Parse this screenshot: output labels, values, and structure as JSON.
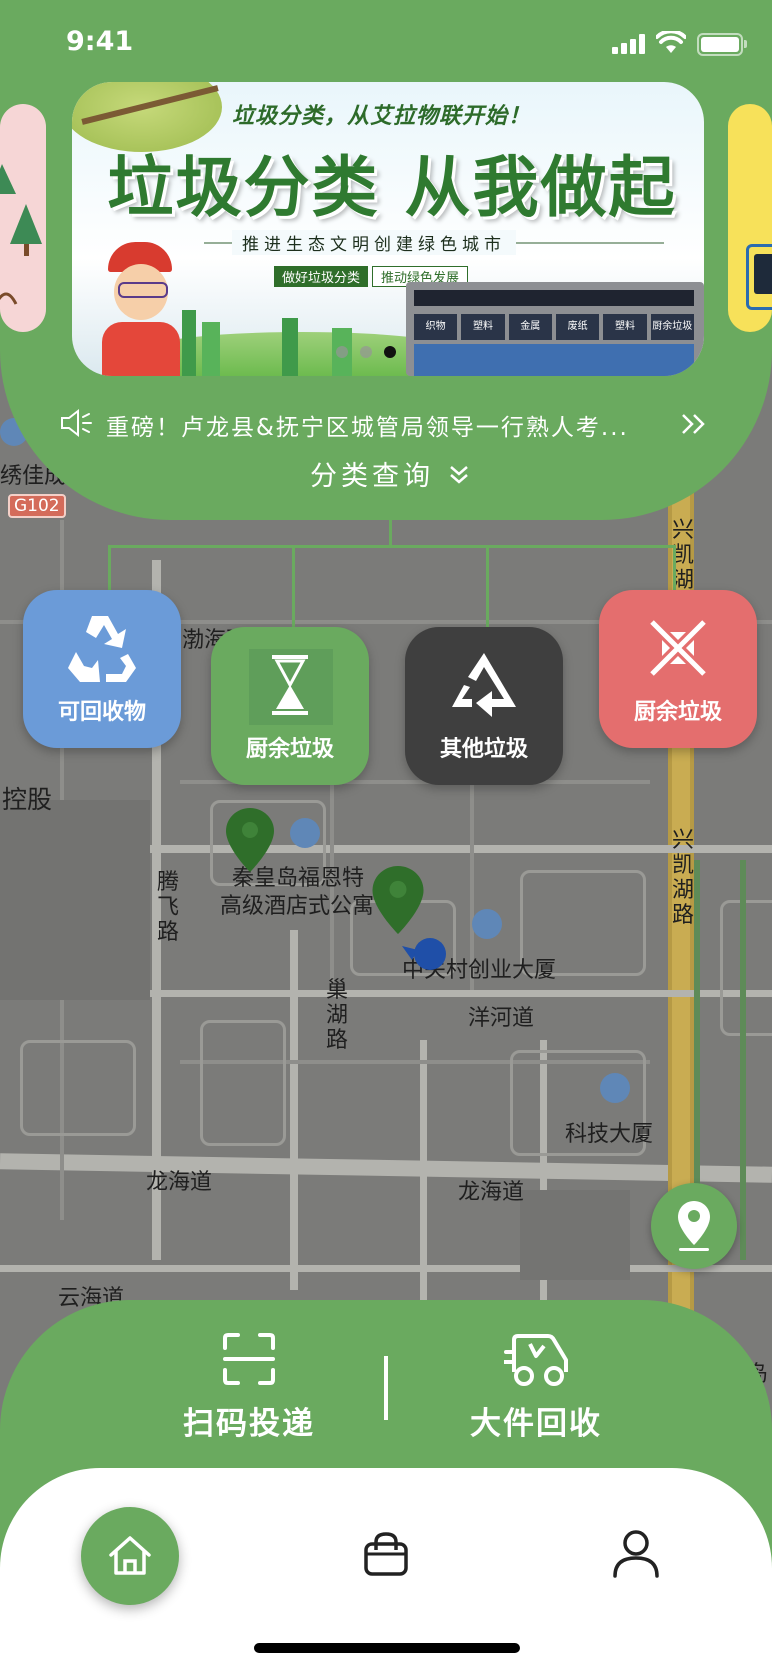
{
  "status_bar": {
    "time": "9:41"
  },
  "banner": {
    "headline": "垃圾分类 从我做起",
    "subline": "垃圾分类，从艾拉物联开始！",
    "slogan": "推进生态文明创建绿色城市",
    "tag_left": "做好垃圾分类",
    "tag_right": "推动绿色发展",
    "bin_labels": [
      "织物",
      "塑料",
      "金属",
      "废纸",
      "塑料",
      "厨余垃圾"
    ],
    "dots_active_index": 2
  },
  "notice": {
    "text": "重磅！卢龙县&抚宁区城管局领导一行熟人考...",
    "more_icon": "double-chevron-right-icon"
  },
  "query": {
    "label": "分类查询",
    "icon": "double-chevron-down-icon"
  },
  "categories": [
    {
      "label": "可回收物",
      "icon": "recycle-icon",
      "color": "#6b9bd8"
    },
    {
      "label": "厨余垃圾",
      "icon": "hourglass-icon",
      "color": "#6aaa5f"
    },
    {
      "label": "其他垃圾",
      "icon": "triangle-recycle-icon",
      "color": "#3f3f3f"
    },
    {
      "label": "厨余垃圾",
      "icon": "cross-arrows-icon",
      "color": "#e46e6e"
    }
  ],
  "map": {
    "labels": {
      "fudao": "渤海西道",
      "kongu": "控股",
      "g102": "G102",
      "xiuja": "绣佳成",
      "tengfei": "腾飞路",
      "hotel1": "秦皇岛福恩特",
      "hotel2": "高级酒店式公寓",
      "zgc": "中关村创业大厦",
      "chaohu": "巢湖路",
      "yanghe": "洋河道",
      "keji": "科技大厦",
      "longhai1": "龙海道",
      "longhai2": "龙海道",
      "yunhai": "云海道",
      "xingkai1": "兴凯湖",
      "xingkai2": "兴凯湖路",
      "dao": "岛"
    }
  },
  "actions": {
    "scan_label": "扫码投递",
    "bulky_label": "大件回收"
  },
  "tabbar": {
    "items": [
      {
        "name": "home",
        "icon": "home-icon"
      },
      {
        "name": "shop",
        "icon": "bag-icon"
      },
      {
        "name": "profile",
        "icon": "user-icon"
      }
    ]
  },
  "colors": {
    "brand_green": "#6aaa5f",
    "map_bg": "#7b7b79",
    "pin_green": "#2f6e2a"
  }
}
